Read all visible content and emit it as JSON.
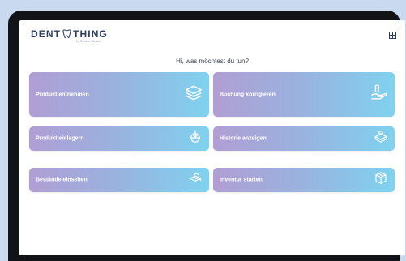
{
  "app": {
    "logo_text_left": "DENT",
    "logo_text_right": "THING",
    "logo_sub": "by Schein Service",
    "menu_icon": "grid-icon"
  },
  "greeting": "Hi, was möchtest du tun?",
  "tiles": [
    {
      "label": "Produkt entnehmen",
      "icon": "layers-icon"
    },
    {
      "label": "Buchung korrigieren",
      "icon": "hand-edit-icon"
    },
    {
      "label": "Produkt einlagern",
      "icon": "inbox-down-icon"
    },
    {
      "label": "Historie anzeigen",
      "icon": "history-box-icon"
    },
    {
      "label": "Bestände einsehen",
      "icon": "inspect-icon"
    },
    {
      "label": "Inventur starten",
      "icon": "boxes-icon"
    }
  ],
  "colors": {
    "accent_dark": "#2c3e63",
    "tile_start": "#b09ed4",
    "tile_end": "#7fd2ef",
    "bezel": "#111316",
    "background": "#c9daf0"
  }
}
